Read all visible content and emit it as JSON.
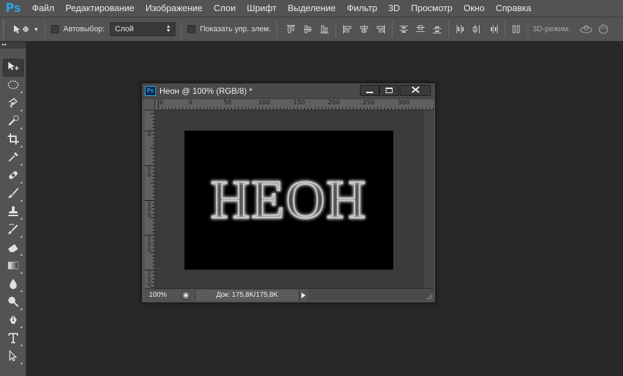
{
  "app": {
    "logo": "Ps"
  },
  "menu": [
    "Файл",
    "Редактирование",
    "Изображение",
    "Слои",
    "Шрифт",
    "Выделение",
    "Фильтр",
    "3D",
    "Просмотр",
    "Окно",
    "Справка"
  ],
  "options": {
    "auto_select_label": "Автовыбор:",
    "layer_select_value": "Слой",
    "show_transform_label": "Показать упр. элем.",
    "mode_3d_label": "3D-режим:"
  },
  "document": {
    "title": "Неон @ 100% (RGB/8) *",
    "canvas_text": "НЕОН",
    "zoom": "100%",
    "doc_info": "Док: 175,8K/175,8K"
  },
  "ruler": {
    "top_labels": [
      "0",
      "0",
      "50",
      "100",
      "150",
      "200",
      "250",
      "300"
    ],
    "left_labels": [
      "0",
      "50",
      "100",
      "150",
      "200"
    ]
  },
  "colors": {
    "accent": "#2fa3e6",
    "panel": "#535353",
    "workspace": "#282828",
    "canvas": "#000000"
  },
  "tools": [
    "move-tool-icon",
    "marquee-tool-icon",
    "lasso-tool-icon",
    "quick-select-tool-icon",
    "crop-tool-icon",
    "eyedropper-tool-icon",
    "healing-brush-tool-icon",
    "brush-tool-icon",
    "clone-stamp-tool-icon",
    "history-brush-tool-icon",
    "eraser-tool-icon",
    "gradient-tool-icon",
    "blur-tool-icon",
    "dodge-tool-icon",
    "pen-tool-icon",
    "type-tool-icon",
    "path-select-tool-icon"
  ]
}
